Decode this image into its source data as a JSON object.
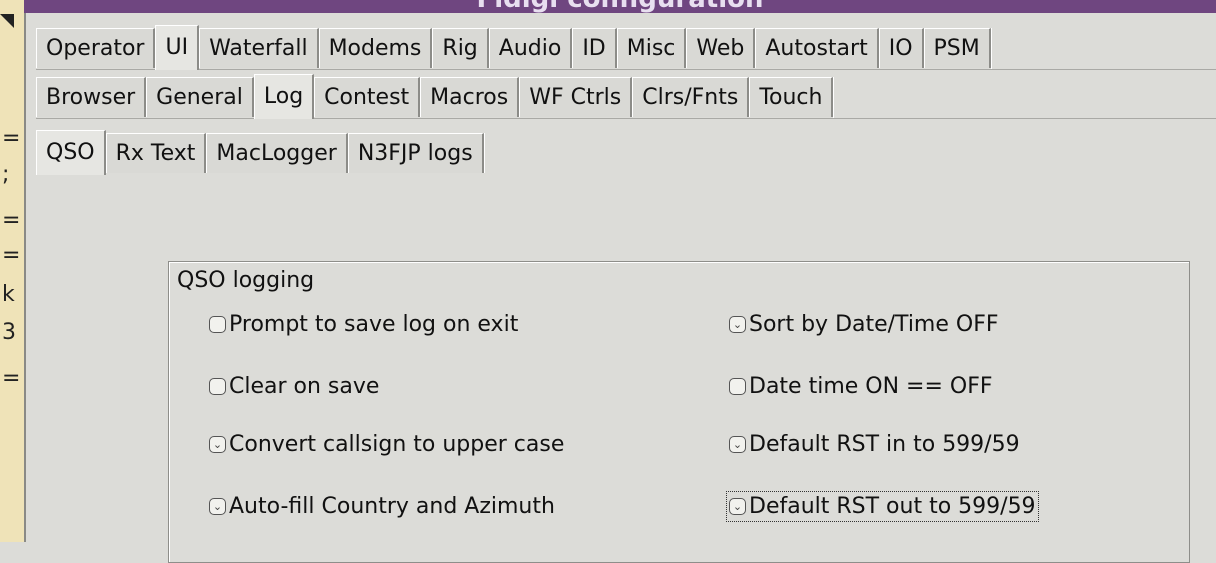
{
  "window": {
    "title": "Fldigi configuration"
  },
  "tabs_main": [
    "Operator",
    "UI",
    "Waterfall",
    "Modems",
    "Rig",
    "Audio",
    "ID",
    "Misc",
    "Web",
    "Autostart",
    "IO",
    "PSM"
  ],
  "tabs_ui": [
    "Browser",
    "General",
    "Log",
    "Contest",
    "Macros",
    "WF Ctrls",
    "Clrs/Fnts",
    "Touch"
  ],
  "tabs_log": [
    "QSO",
    "Rx Text",
    "MacLogger",
    "N3FJP logs"
  ],
  "group": {
    "label": "QSO logging",
    "left": [
      {
        "label": "Prompt to save log on exit",
        "checked": false
      },
      {
        "label": "Clear on save",
        "checked": false
      },
      {
        "label": "Convert callsign to upper case",
        "checked": true
      },
      {
        "label": "Auto-fill Country and Azimuth",
        "checked": true
      }
    ],
    "right": [
      {
        "label": "Sort by Date/Time OFF",
        "checked": true
      },
      {
        "label": "Date time ON == OFF",
        "checked": false
      },
      {
        "label": "Default RST in to 599/59",
        "checked": true
      },
      {
        "label": "Default RST out to 599/59",
        "checked": true
      }
    ]
  },
  "icons": {
    "check": "check-icon"
  }
}
